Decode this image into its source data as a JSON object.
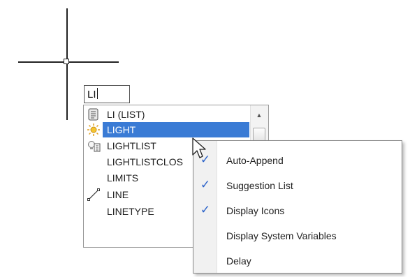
{
  "command_line": {
    "input_value": "LI"
  },
  "suggestion_list": {
    "items": [
      {
        "label": "LI (LIST)",
        "icon": "list-scroll-icon"
      },
      {
        "label": "LIGHT",
        "icon": "sun-light-icon",
        "selected": true
      },
      {
        "label": "LIGHTLIST",
        "icon": "lightlist-icon"
      },
      {
        "label": "LIGHTLISTCLOS",
        "icon": ""
      },
      {
        "label": "LIMITS",
        "icon": ""
      },
      {
        "label": "LINE",
        "icon": "line-icon"
      },
      {
        "label": "LINETYPE",
        "icon": ""
      }
    ],
    "scroll_up_glyph": "▲"
  },
  "context_menu": {
    "items": [
      {
        "label": "Auto-Append",
        "checked": true,
        "check_glyph": "✓"
      },
      {
        "label": "Suggestion List",
        "checked": true,
        "check_glyph": "✓"
      },
      {
        "label": "Display Icons",
        "checked": true,
        "check_glyph": "✓"
      },
      {
        "label": "Display System Variables",
        "checked": false,
        "check_glyph": ""
      },
      {
        "label": "Delay",
        "checked": false,
        "check_glyph": ""
      }
    ]
  },
  "colors": {
    "selection": "#3a7bd5",
    "check": "#2a62c9"
  }
}
